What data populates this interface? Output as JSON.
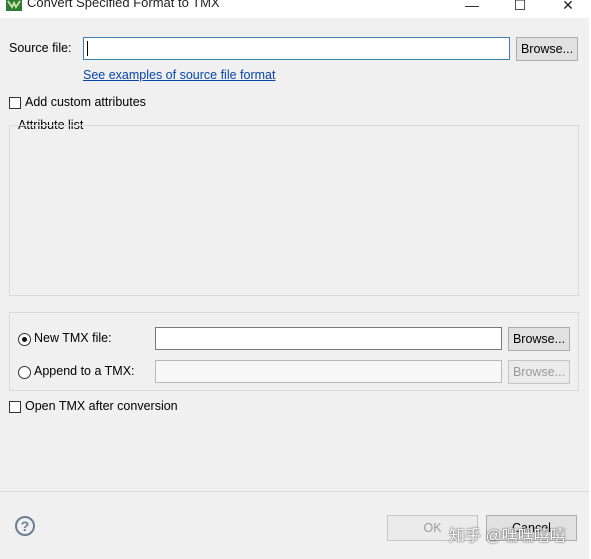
{
  "window": {
    "title": "Convert Specified Format to TMX",
    "minimize_glyph": "—",
    "maximize_glyph": "☐",
    "close_glyph": "✕"
  },
  "source": {
    "label": "Source file:",
    "value": "",
    "browse_label": "Browse...",
    "examples_link": "See examples of source file format"
  },
  "attributes": {
    "add_custom_label": "Add custom attributes",
    "add_custom_checked": false,
    "attribute_list_label": "Attribute list"
  },
  "target": {
    "new_tmx_label": "New TMX file:",
    "new_tmx_selected": true,
    "new_tmx_value": "",
    "new_tmx_browse": "Browse...",
    "append_label": "Append to a TMX:",
    "append_selected": false,
    "append_value": "",
    "append_browse": "Browse..."
  },
  "options": {
    "open_after_label": "Open TMX after conversion",
    "open_after_checked": false
  },
  "footer": {
    "help_glyph": "?",
    "ok_label": "OK",
    "cancel_label": "Cancel",
    "watermark": "知乎 @嘿嘿嘻嘻"
  },
  "colors": {
    "link": "#0645ad",
    "focus_border": "#3c7fb1",
    "dialog_bg": "#f0f0f0"
  }
}
